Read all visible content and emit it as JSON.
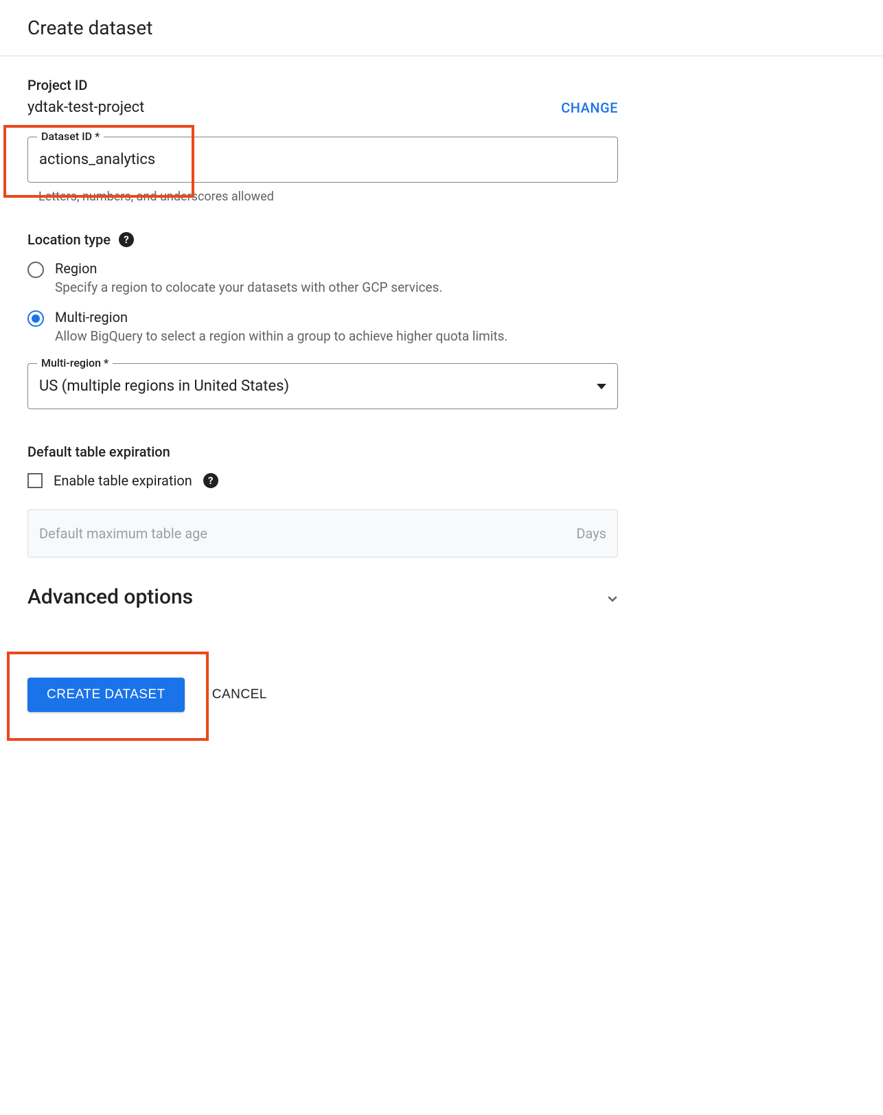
{
  "page": {
    "title": "Create dataset"
  },
  "project": {
    "label": "Project ID",
    "value": "ydtak-test-project",
    "change_label": "CHANGE"
  },
  "dataset": {
    "label": "Dataset ID *",
    "value": "actions_analytics",
    "helper": "Letters, numbers, and underscores allowed"
  },
  "location": {
    "heading": "Location type",
    "help": "?",
    "options": [
      {
        "title": "Region",
        "desc": "Specify a region to colocate your datasets with other GCP services.",
        "selected": false
      },
      {
        "title": "Multi-region",
        "desc": "Allow BigQuery to select a region within a group to achieve higher quota limits.",
        "selected": true
      }
    ],
    "select": {
      "label": "Multi-region *",
      "value": "US (multiple regions in United States)"
    }
  },
  "expiration": {
    "heading": "Default table expiration",
    "checkbox_label": "Enable table expiration",
    "help": "?",
    "placeholder": "Default maximum table age",
    "unit": "Days"
  },
  "advanced": {
    "title": "Advanced options"
  },
  "buttons": {
    "create": "CREATE DATASET",
    "cancel": "CANCEL"
  }
}
